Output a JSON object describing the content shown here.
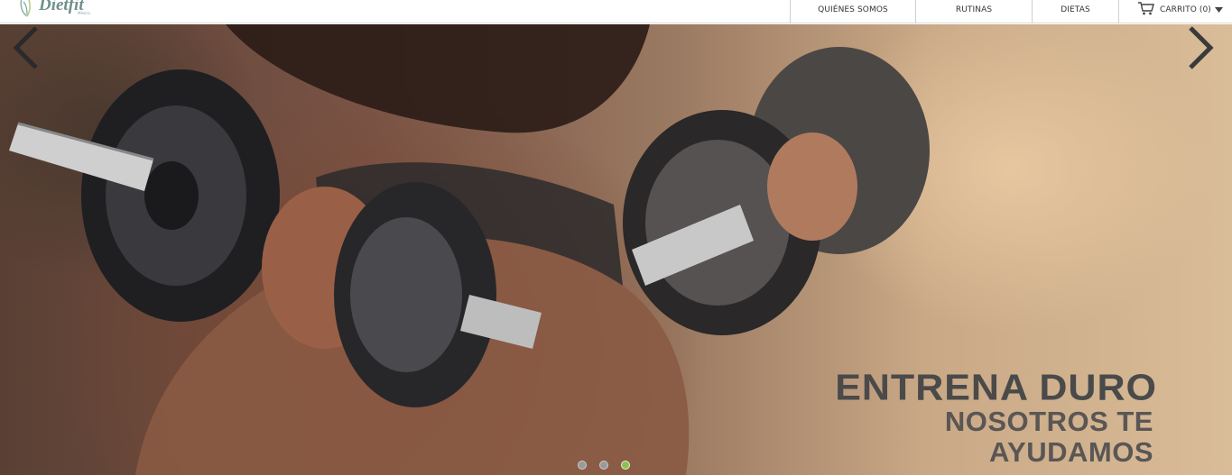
{
  "header": {
    "logo_text": "Dietfit",
    "logo_sub": "México",
    "nav": [
      {
        "label": "QUIÉNES SOMOS"
      },
      {
        "label": "RUTINAS"
      },
      {
        "label": "DIETAS"
      }
    ],
    "cart_label": "CARRITO (0)"
  },
  "hero": {
    "title": "ENTRENA DURO",
    "subtitle": "NOSOTROS TE AYUDAMOS",
    "slides_count": 3,
    "active_slide": 3
  },
  "colors": {
    "active_dot": "#8ec14b",
    "caption": "#4a4a4a",
    "logo": "#6e8f8a"
  }
}
